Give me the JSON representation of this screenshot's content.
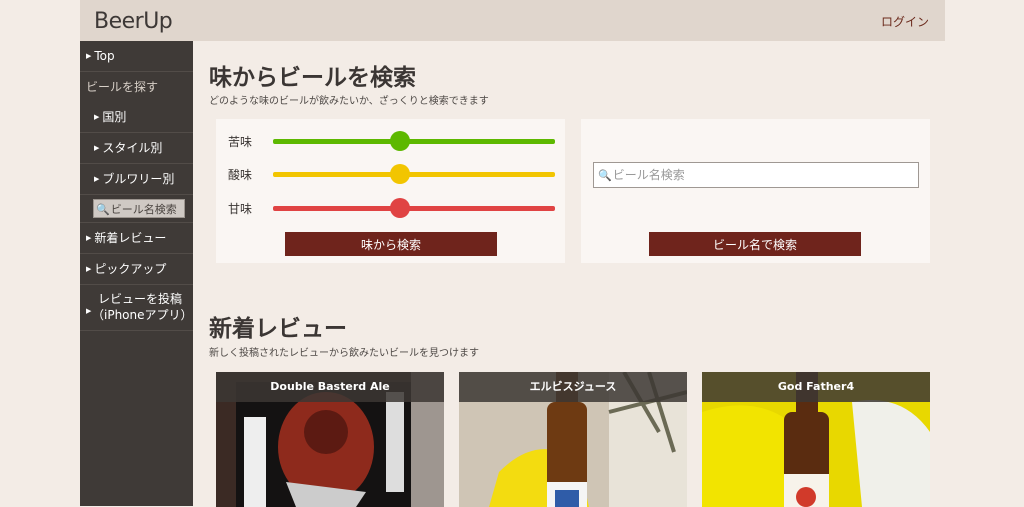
{
  "header": {
    "logo_text": "BeerUp",
    "login_label": "ログイン"
  },
  "sidebar": {
    "top_label": "Top",
    "find_heading": "ビールを探す",
    "by_country": "国別",
    "by_style": "スタイル別",
    "by_brewery": "ブルワリー別",
    "name_search": "ビール名検索",
    "new_reviews": "新着レビュー",
    "pickup": "ピックアップ",
    "post_review_line1": "レビューを投稿",
    "post_review_line2": "（iPhoneアプリ）"
  },
  "taste_search": {
    "title": "味からビールを検索",
    "subtitle": "どのような味のビールが飲みたいか、ざっくりと検索できます",
    "sliders": [
      {
        "label": "苦味",
        "value": 0.45,
        "color": "#5db800"
      },
      {
        "label": "酸味",
        "value": 0.45,
        "color": "#f2c500"
      },
      {
        "label": "甘味",
        "value": 0.45,
        "color": "#e04343"
      }
    ],
    "taste_button": "味から検索",
    "name_placeholder": "ビール名検索",
    "name_button": "ビール名で検索"
  },
  "reviews": {
    "title": "新着レビュー",
    "subtitle": "新しく投稿されたレビューから飲みたいビールを見つけます",
    "cards": [
      {
        "title": "Double Basterd Ale"
      },
      {
        "title": "エルビスジュース"
      },
      {
        "title": "God Father4"
      }
    ]
  }
}
